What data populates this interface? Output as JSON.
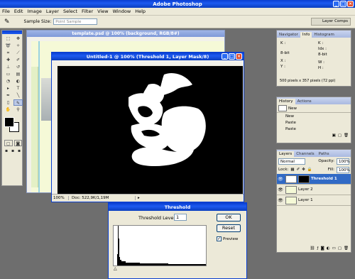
{
  "app": {
    "title": "Adobe Photoshop"
  },
  "menu": [
    "File",
    "Edit",
    "Image",
    "Layer",
    "Select",
    "Filter",
    "View",
    "Window",
    "Help"
  ],
  "options": {
    "sample_size_label": "Sample Size:",
    "sample_size_value": "Point Sample",
    "layer_comps": "Layer Comps"
  },
  "doc_back": {
    "title": "template.psd @ 100% (background, RGB/8#)"
  },
  "doc_front": {
    "title": "Untitled-1 @ 100% (Threshold 1, Layer Mask/8)",
    "zoom": "100%",
    "doc_info": "Doc: 522,9K/1,19M"
  },
  "threshold": {
    "title": "Threshold",
    "level_label": "Threshold Level:",
    "level_value": "1",
    "ok": "OK",
    "reset": "Reset",
    "preview": "Preview",
    "preview_checked": true
  },
  "info_panel": {
    "tabs": [
      "Navigator",
      "Info",
      "Histogram"
    ],
    "k1": "K :",
    "k2": "K :",
    "bit1": "8-bit",
    "bit2": "8-bit",
    "idx": "Idx :",
    "x": "X :",
    "y": "Y :",
    "w": "W :",
    "h": "H :",
    "size": "500 pixels x 357 pixels (72 ppi)"
  },
  "history_panel": {
    "tabs": [
      "History",
      "Actions"
    ],
    "items": [
      "New",
      "New",
      "Paste",
      "Paste"
    ]
  },
  "layers_panel": {
    "tabs": [
      "Layers",
      "Channels",
      "Paths"
    ],
    "blend": "Normal",
    "opacity_label": "Opacity:",
    "opacity": "100%",
    "lock_label": "Lock:",
    "fill_label": "Fill:",
    "fill": "100%",
    "layers": [
      "Threshold 1",
      "Layer 2",
      "Layer 1"
    ]
  },
  "colors": {
    "titlebar": "#0a3fd0",
    "panel": "#ece9d8",
    "workspace": "#6e6e6e"
  }
}
